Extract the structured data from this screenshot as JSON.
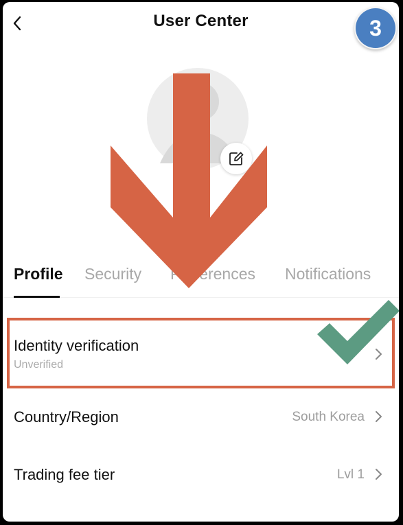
{
  "header": {
    "title": "User Center",
    "step_number": "3"
  },
  "icons": {
    "back": "chevron-left-icon",
    "avatar": "user-avatar-placeholder",
    "edit": "edit-pencil-icon",
    "row_chevron": "chevron-right-icon"
  },
  "tabs": [
    {
      "label": "Profile",
      "active": true
    },
    {
      "label": "Security",
      "active": false
    },
    {
      "label": "Preferences",
      "active": false
    },
    {
      "label": "Notifications",
      "active": false
    }
  ],
  "rows": [
    {
      "label": "Identity verification",
      "subtitle": "Unverified",
      "value": ""
    },
    {
      "label": "Country/Region",
      "value": "South Korea"
    },
    {
      "label": "Trading fee tier",
      "value": "Lvl 1"
    }
  ],
  "annotations": {
    "arrow_color": "#d66445",
    "highlight_color": "#d66445",
    "check_color": "#5c9b82",
    "badge_color": "#4a7fc1"
  }
}
